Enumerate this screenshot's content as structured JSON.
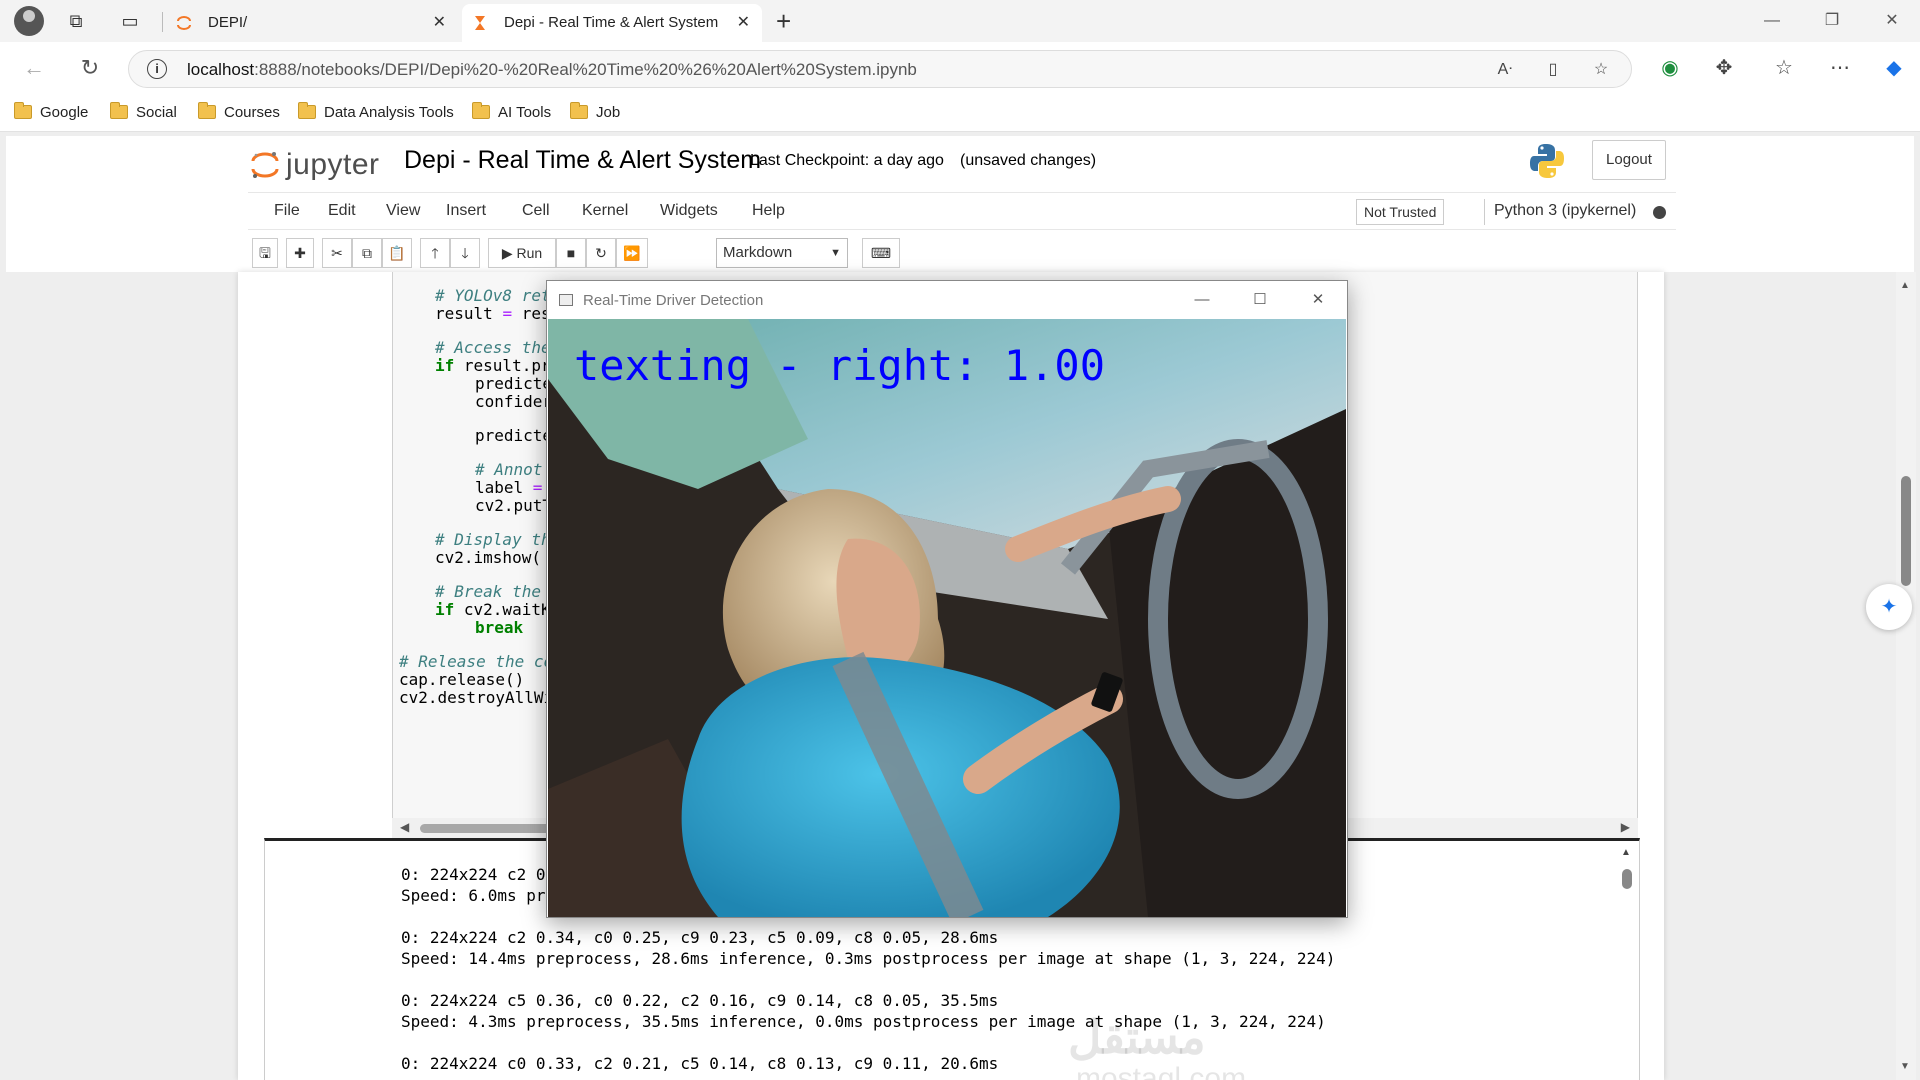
{
  "browser": {
    "tabs": [
      {
        "title": "DEPI/",
        "active": false
      },
      {
        "title": "Depi - Real Time & Alert System",
        "active": true
      }
    ],
    "url_host": "localhost",
    "url_path": ":8888/notebooks/DEPI/Depi%20-%20Real%20Time%20%26%20Alert%20System.ipynb",
    "bookmarks": [
      "Google",
      "Social",
      "Courses",
      "Data Analysis Tools",
      "AI Tools",
      "Job"
    ]
  },
  "jupyter": {
    "logo_text": "jupyter",
    "notebook_title": "Depi - Real Time & Alert System",
    "checkpoint": "Last Checkpoint: a day ago",
    "unsaved": "(unsaved changes)",
    "logout_label": "Logout",
    "menu": [
      "File",
      "Edit",
      "View",
      "Insert",
      "Cell",
      "Kernel",
      "Widgets",
      "Help"
    ],
    "trust_status": "Not Trusted",
    "kernel": "Python 3 (ipykernel)",
    "run_label": "Run",
    "cell_type": "Markdown",
    "colors": {
      "brand_orange": "#f37726",
      "label_blue": "#0000ff"
    }
  },
  "code": {
    "lines": [
      {
        "type": "comment",
        "text": "# YOLOv8 ret"
      },
      {
        "type": "code",
        "text": "result = res"
      },
      {
        "type": "comment",
        "text": "# Access the"
      },
      {
        "type": "code",
        "text": "if result.pr",
        "kw": "if"
      },
      {
        "type": "code",
        "text": "predicte"
      },
      {
        "type": "code",
        "text": "confider"
      },
      {
        "type": "code",
        "text": "predicte"
      },
      {
        "type": "comment",
        "text": "# Annot"
      },
      {
        "type": "code",
        "text": "label = "
      },
      {
        "type": "code",
        "text": "cv2.putT"
      },
      {
        "type": "comment",
        "text": "# Display th"
      },
      {
        "type": "code",
        "text": "cv2.imshow("
      },
      {
        "type": "comment",
        "text": "# Break the"
      },
      {
        "type": "code",
        "text": "if cv2.waitK",
        "kw": "if"
      },
      {
        "type": "kw",
        "text": "break"
      },
      {
        "type": "comment",
        "text": "# Release the co"
      },
      {
        "type": "code",
        "text": "cap.release()"
      },
      {
        "type": "code",
        "text": "cv2.destroyAllWi"
      }
    ]
  },
  "output": {
    "lines": [
      "0: 224x224 c2 0",
      "Speed: 6.0ms pre",
      "",
      "0: 224x224 c2 0.34, c0 0.25, c9 0.23, c5 0.09, c8 0.05, 28.6ms",
      "Speed: 14.4ms preprocess, 28.6ms inference, 0.3ms postprocess per image at shape (1, 3, 224, 224)",
      "",
      "0: 224x224 c5 0.36, c0 0.22, c2 0.16, c9 0.14, c8 0.05, 35.5ms",
      "Speed: 4.3ms preprocess, 35.5ms inference, 0.0ms postprocess per image at shape (1, 3, 224, 224)",
      "",
      "0: 224x224 c0 0.33, c2 0.21, c5 0.14, c8 0.13, c9 0.11, 20.6ms"
    ]
  },
  "cv_window": {
    "title": "Real-Time Driver Detection",
    "overlay_label": "texting - right: 1.00"
  },
  "watermark": {
    "arabic": "مستقل",
    "latin": "mostaql.com"
  }
}
